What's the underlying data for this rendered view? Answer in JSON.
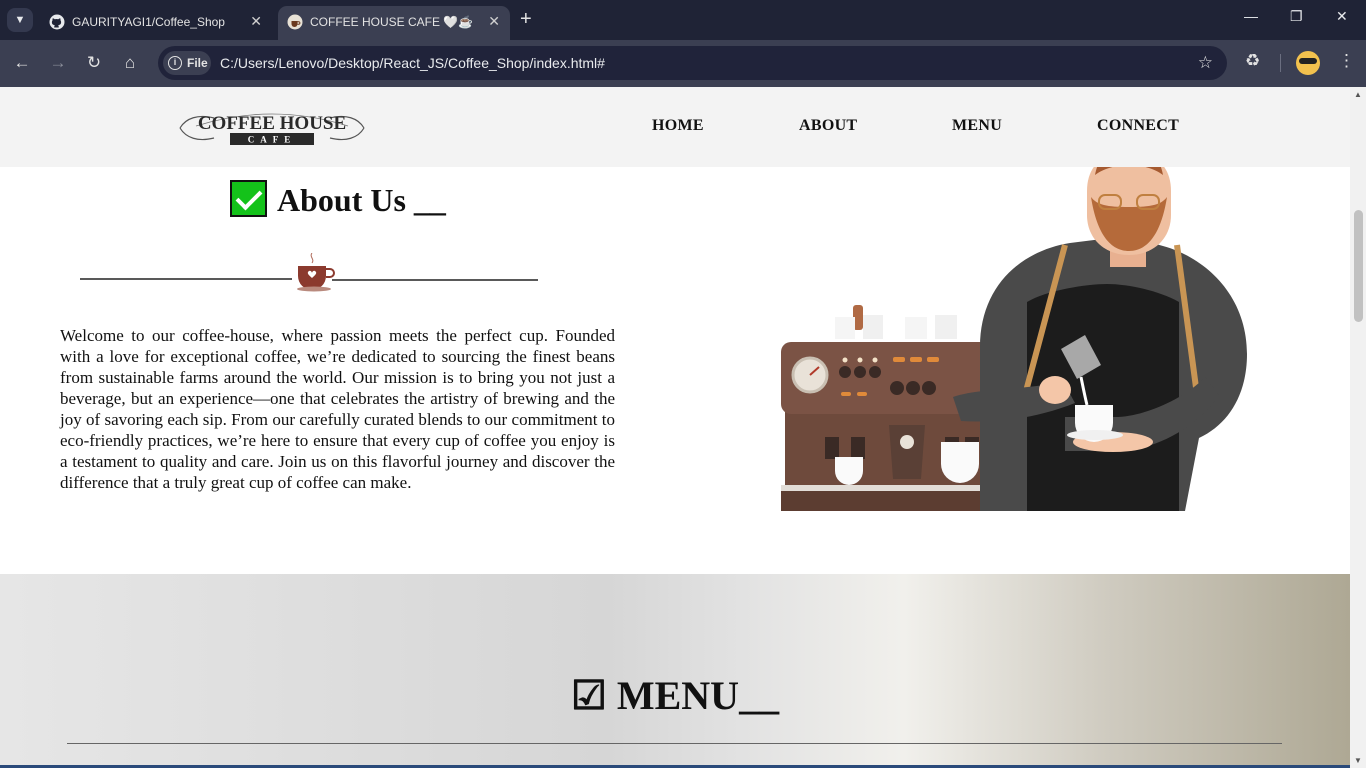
{
  "browser": {
    "tabs": [
      {
        "title": "GAURITYAGI1/Coffee_Shop",
        "favicon": "github-icon",
        "active": false
      },
      {
        "title": "COFFEE HOUSE CAFE 🤍☕",
        "favicon": "coffee-favicon-icon",
        "active": true
      }
    ],
    "address_chip": "File",
    "url": "C:/Users/Lenovo/Desktop/React_JS/Coffee_Shop/index.html#"
  },
  "site": {
    "logo": {
      "main": "COFFEE HOUSE",
      "sub": "CAFE"
    },
    "nav": [
      "HOME",
      "ABOUT",
      "MENU",
      "CONNECT"
    ],
    "about": {
      "title": "About Us __",
      "text": "Welcome to our coffee-house, where passion meets the perfect cup. Founded with a love for exceptional coffee, we’re dedicated to sourcing the finest beans from sustainable farms around the world. Our mission is to bring you not just a beverage, but an experience—one that celebrates the artistry of brewing and the joy of savoring each sip. From our carefully curated blends to our commitment to eco-friendly practices, we’re here to ensure that every cup of coffee you enjoy is a testament to quality and care. Join us on this flavorful journey and discover the difference that a truly great cup of coffee can make."
    },
    "menu": {
      "title": "☑ MENU__"
    }
  },
  "colors": {
    "chrome_dark": "#1f2336",
    "chrome_toolbar": "#3b3f52",
    "header_bg": "#f3f3f3",
    "check_green": "#14c21a",
    "cup_brown": "#8b3a2e"
  }
}
